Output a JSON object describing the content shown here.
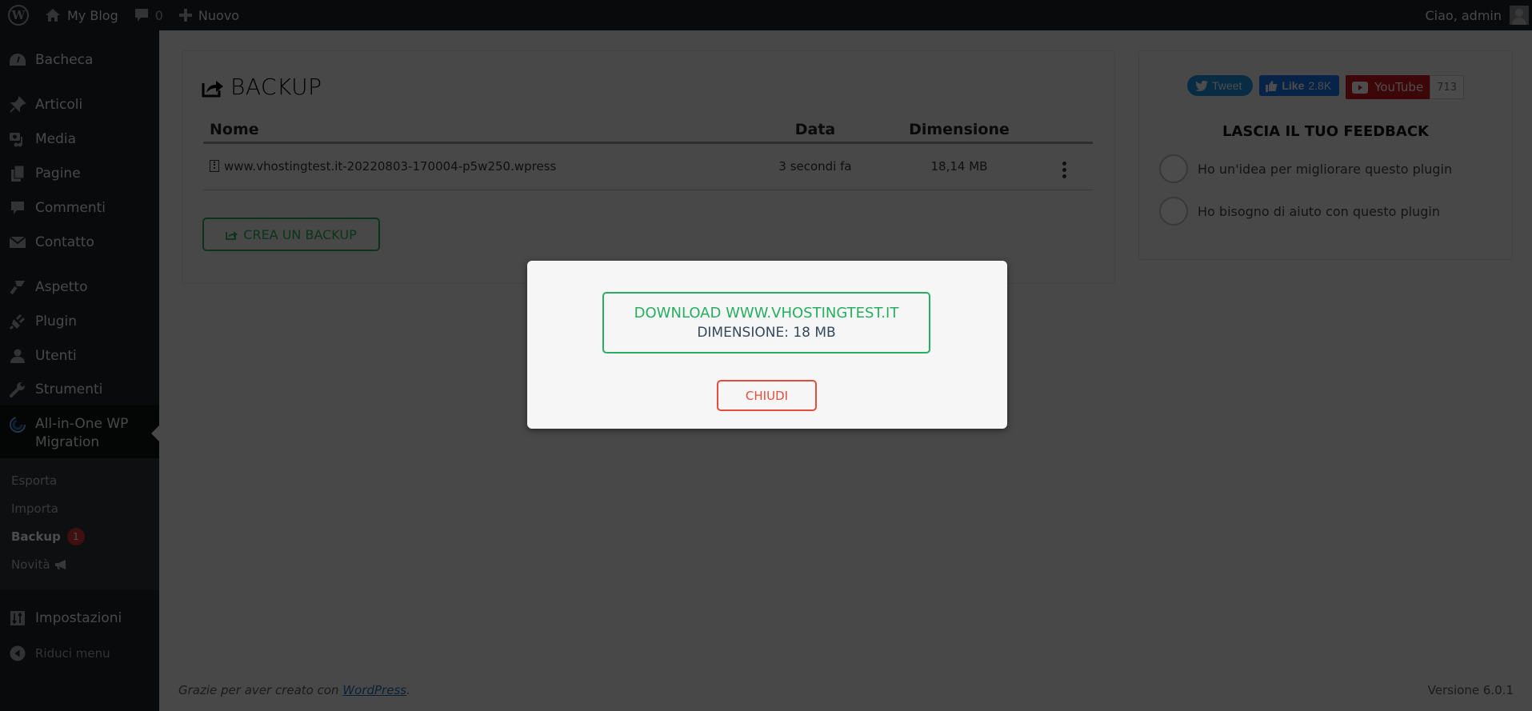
{
  "adminbar": {
    "site_name": "My Blog",
    "comments_count": "0",
    "new_label": "Nuovo",
    "greeting": "Ciao, admin"
  },
  "sidebar": {
    "items": [
      {
        "label": "Bacheca",
        "icon": "dashboard-icon"
      },
      {
        "label": "Articoli",
        "icon": "pin-icon"
      },
      {
        "label": "Media",
        "icon": "media-icon"
      },
      {
        "label": "Pagine",
        "icon": "pages-icon"
      },
      {
        "label": "Commenti",
        "icon": "comment-icon"
      },
      {
        "label": "Contatto",
        "icon": "mail-icon"
      },
      {
        "label": "Aspetto",
        "icon": "brush-icon"
      },
      {
        "label": "Plugin",
        "icon": "plug-icon"
      },
      {
        "label": "Utenti",
        "icon": "user-icon"
      },
      {
        "label": "Strumenti",
        "icon": "wrench-icon"
      },
      {
        "label": "All-in-One WP Migration",
        "icon": "migration-icon"
      },
      {
        "label": "Impostazioni",
        "icon": "settings-icon"
      },
      {
        "label": "Riduci menu",
        "icon": "collapse-icon"
      }
    ],
    "submenu": [
      {
        "label": "Esporta"
      },
      {
        "label": "Importa"
      },
      {
        "label": "Backup",
        "badge": "1"
      },
      {
        "label": "Novità",
        "icon": "megaphone-icon"
      }
    ]
  },
  "backup": {
    "title": "BACKUP",
    "columns": [
      "Nome",
      "Data",
      "Dimensione"
    ],
    "rows": [
      {
        "name": "www.vhostingtest.it-20220803-170004-p5w250.wpress",
        "date": "3 secondi fa",
        "size": "18,14 MB"
      }
    ],
    "create_label": "CREA UN BACKUP"
  },
  "feedback": {
    "tweet_label": "Tweet",
    "like_label": "Like",
    "like_count": "2.8K",
    "youtube_label": "YouTube",
    "youtube_count": "713",
    "title": "LASCIA IL TUO FEEDBACK",
    "options": [
      "Ho un'idea per migliorare questo plugin",
      "Ho bisogno di aiuto con questo plugin"
    ]
  },
  "footer": {
    "thanks_prefix": "Grazie per aver creato con ",
    "wordpress_link": "WordPress",
    "thanks_suffix": ".",
    "version": "Versione 6.0.1"
  },
  "modal": {
    "download_label": "DOWNLOAD WWW.VHOSTINGTEST.IT",
    "size_label": "DIMENSIONE: 18 MB",
    "close_label": "CHIUDI"
  },
  "colors": {
    "success": "#27ae60",
    "danger": "#e74c3c",
    "adminbar_bg": "#1d2327",
    "overlay": "rgba(0,0,0,0.7)"
  }
}
